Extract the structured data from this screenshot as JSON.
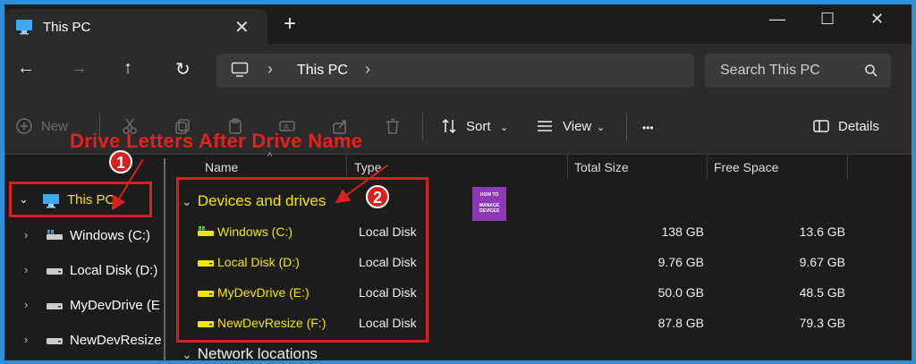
{
  "tab": {
    "title": "This PC",
    "close_glyph": "✕",
    "new_tab_glyph": "+"
  },
  "window_controls": {
    "minimize": "—",
    "maximize": "☐",
    "close": "✕"
  },
  "nav": {
    "back": "←",
    "forward": "→",
    "up": "↑",
    "refresh": "↻"
  },
  "address": {
    "crumb": "This PC",
    "separator": "›"
  },
  "search": {
    "placeholder": "Search This PC"
  },
  "commands": {
    "new_label": "New",
    "sort_label": "Sort",
    "view_label": "View",
    "more_label": "•••",
    "details_label": "Details"
  },
  "annotation": {
    "title": "Drive Letters After Drive Name",
    "badge1": "1",
    "badge2": "2"
  },
  "sidebar": {
    "items": [
      {
        "label": "This PC",
        "icon": "monitor-icon"
      },
      {
        "label": "Windows (C:)",
        "icon": "windows-drive-icon"
      },
      {
        "label": "Local Disk (D:)",
        "icon": "drive-icon"
      },
      {
        "label": "MyDevDrive (E",
        "icon": "drive-icon"
      },
      {
        "label": "NewDevResize",
        "icon": "drive-icon"
      }
    ]
  },
  "columns": {
    "name": "Name",
    "type": "Type",
    "total_size": "Total Size",
    "free_space": "Free Space"
  },
  "groups": {
    "devices": "Devices and drives",
    "network": "Network locations"
  },
  "logo_text": {
    "line1": "HOW TO",
    "line2": "MANAGE",
    "line3": "DEVICES"
  },
  "drives": [
    {
      "name": "Windows (C:)",
      "type": "Local Disk",
      "total": "138 GB",
      "free": "13.6 GB"
    },
    {
      "name": "Local Disk (D:)",
      "type": "Local Disk",
      "total": "9.76 GB",
      "free": "9.67 GB"
    },
    {
      "name": "MyDevDrive (E:)",
      "type": "Local Disk",
      "total": "50.0 GB",
      "free": "48.5 GB"
    },
    {
      "name": "NewDevResize (F:)",
      "type": "Local Disk",
      "total": "87.8 GB",
      "free": "79.3 GB"
    }
  ],
  "colors": {
    "annotation_red": "#d92020",
    "highlight_yellow": "#f2e600",
    "border_blue": "#2b8fd9"
  }
}
